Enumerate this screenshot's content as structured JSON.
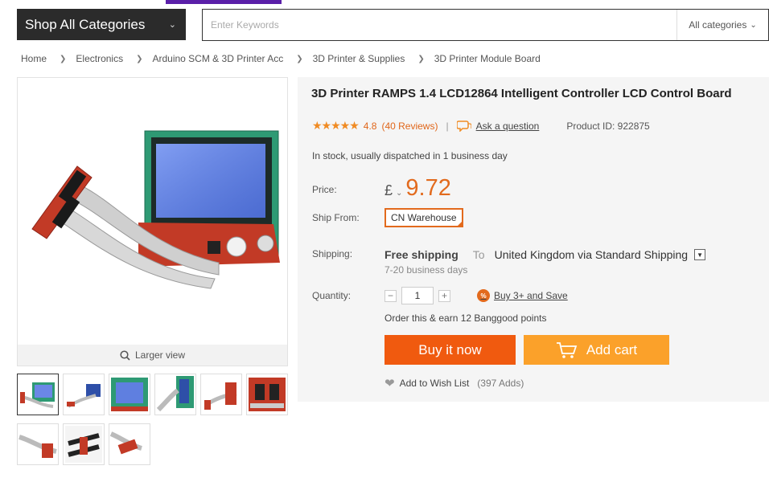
{
  "header": {
    "shop_all_label": "Shop All Categories",
    "search_placeholder": "Enter Keywords",
    "search_scope": "All categories"
  },
  "breadcrumb": {
    "items": [
      "Home",
      "Electronics",
      "Arduino SCM & 3D Printer Acc",
      "3D Printer & Supplies",
      "3D Printer Module Board"
    ]
  },
  "gallery": {
    "larger_view": "Larger view",
    "thumbnail_count": 9
  },
  "product": {
    "title": "3D Printer RAMPS 1.4 LCD12864 Intelligent Controller LCD Control Board",
    "rating_value": "4.8",
    "reviews": "(40 Reviews)",
    "separator": "|",
    "ask_question": "Ask a question",
    "product_id": "Product ID: 922875",
    "stock": "In stock, usually dispatched in 1 business day",
    "price_label": "Price:",
    "currency": "£",
    "price": "9.72",
    "ship_from_label": "Ship From:",
    "ship_from_value": "CN Warehouse",
    "shipping_label": "Shipping:",
    "free_shipping": "Free shipping",
    "to": "To",
    "destination": "United Kingdom via Standard Shipping",
    "delivery_days": "7-20 business days",
    "quantity_label": "Quantity:",
    "quantity": "1",
    "minus": "−",
    "plus": "+",
    "buy3_badge": "%",
    "buy3_label": "Buy 3+ and Save",
    "earn_points": "Order this & earn 12 Banggood points",
    "buy_now": "Buy it now",
    "add_cart": "Add cart",
    "wishlist": "Add to Wish List",
    "wishlist_adds": "(397 Adds)"
  },
  "colors": {
    "accent_orange": "#f05a0f",
    "cart_orange": "#fba12a",
    "price_orange": "#e26a1d",
    "dark_header": "#2b2b2b"
  }
}
